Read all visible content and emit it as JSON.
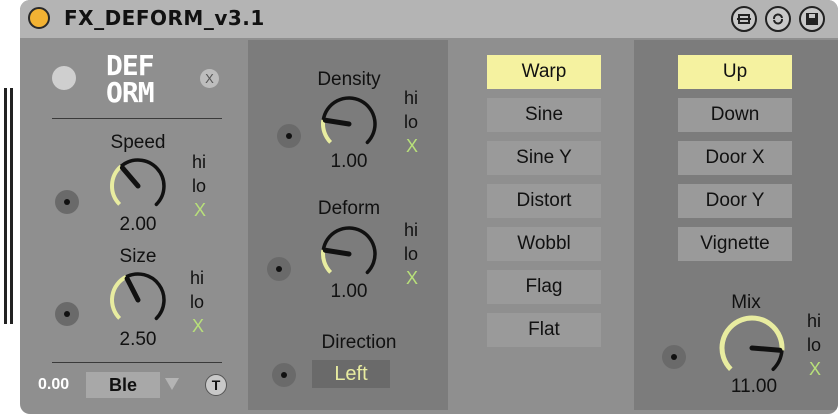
{
  "title": "FX_DEFORM_v3.1",
  "logo_text": [
    "DEF",
    "ORM"
  ],
  "logo_close": "X",
  "speed": {
    "label": "Speed",
    "value": "2.00",
    "hi": "hi",
    "lo": "lo",
    "x": "X",
    "level": 0.35
  },
  "size": {
    "label": "Size",
    "value": "2.50",
    "hi": "hi",
    "lo": "lo",
    "x": "X",
    "level": 0.4
  },
  "density": {
    "label": "Density",
    "value": "1.00",
    "hi": "hi",
    "lo": "lo",
    "x": "X",
    "level": 0.2
  },
  "deform": {
    "label": "Deform",
    "value": "1.00",
    "hi": "hi",
    "lo": "lo",
    "x": "X",
    "level": 0.2
  },
  "direction": {
    "label": "Direction",
    "value": "Left"
  },
  "mix": {
    "label": "Mix",
    "value": "11.00",
    "hi": "hi",
    "lo": "lo",
    "x": "X",
    "level": 0.85
  },
  "footer": {
    "value": "0.00",
    "blend": "Ble",
    "t_button": "T"
  },
  "modes": {
    "items": [
      "Warp",
      "Sine",
      "Sine Y",
      "Distort",
      "Wobbl",
      "Flag",
      "Flat"
    ],
    "selected": "Warp"
  },
  "directions": {
    "items": [
      "Up",
      "Down",
      "Door X",
      "Door Y",
      "Vignette"
    ],
    "selected": "Up"
  },
  "colors": {
    "accent": "#f5f2a0",
    "arc": "#e8eca0",
    "x_green": "#b8e07a",
    "title_dot": "#f2b233"
  }
}
